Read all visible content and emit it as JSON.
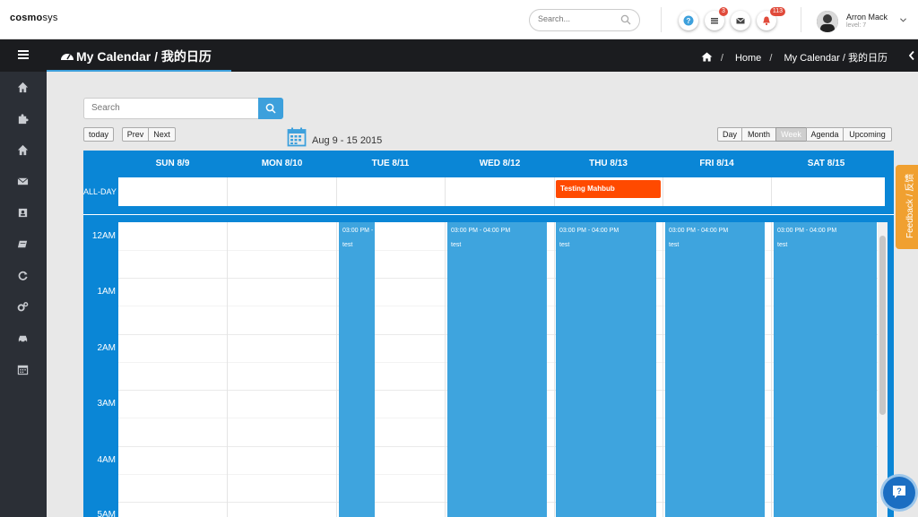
{
  "brand": {
    "part1": "cosmo",
    "part2": "sys"
  },
  "top_search": {
    "placeholder": "Search..."
  },
  "notifications": {
    "tasks": "3",
    "alerts": "113"
  },
  "user": {
    "name": "Arron Mack",
    "level": "level: 7"
  },
  "header": {
    "title": "My Calendar / 我的日历"
  },
  "breadcrumb": {
    "home": "Home",
    "sep": "/",
    "current": "My Calendar / 我的日历"
  },
  "calendar": {
    "search_placeholder": "Search",
    "nav": {
      "today": "today",
      "prev": "Prev",
      "next": "Next"
    },
    "range": "Aug 9 - 15 2015",
    "views": {
      "day": "Day",
      "month": "Month",
      "week": "Week",
      "agenda": "Agenda",
      "upcoming": "Upcoming"
    },
    "selected_view": "Week",
    "days": [
      "SUN 8/9",
      "MON 8/10",
      "TUE 8/11",
      "WED 8/12",
      "THU 8/13",
      "FRI 8/14",
      "SAT 8/15"
    ],
    "all_day_label": "ALL-DAY",
    "all_day_event": {
      "title": "Testing Mahbub",
      "day": "THU 8/13"
    },
    "hours": [
      "12AM",
      "1AM",
      "2AM",
      "3AM",
      "4AM",
      "5AM"
    ],
    "events": [
      {
        "day": "TUE 8/11",
        "time": "03:00 PM - 04:00 PM",
        "title": "test",
        "shown_time": "03:00 PM -"
      },
      {
        "day": "WED 8/12",
        "time": "03:00 PM - 04:00 PM",
        "title": "test",
        "shown_time": "03:00 PM - 04:00 PM"
      },
      {
        "day": "THU 8/13",
        "time": "03:00 PM - 04:00 PM",
        "title": "test",
        "shown_time": "03:00 PM - 04:00 PM"
      },
      {
        "day": "FRI 8/14",
        "time": "03:00 PM - 04:00 PM",
        "title": "test",
        "shown_time": "03:00 PM - 04:00 PM"
      },
      {
        "day": "SAT 8/15",
        "time": "03:00 PM - 04:00 PM",
        "title": "test",
        "shown_time": "03:00 PM - 04:00 PM"
      }
    ]
  },
  "feedback": {
    "label": "Feedback / 反馈"
  },
  "colors": {
    "accent": "#3da0dc",
    "calendar_header": "#0a86d6",
    "event": "#3ea4de",
    "all_day_event": "#ff4a00",
    "feedback": "#f0a030"
  },
  "sidebar_icons": [
    "home-icon",
    "puzzle-icon",
    "home-icon",
    "envelope-icon",
    "contact-card-icon",
    "book-icon",
    "refresh-icon",
    "cogs-icon",
    "car-icon",
    "calendar-icon"
  ]
}
